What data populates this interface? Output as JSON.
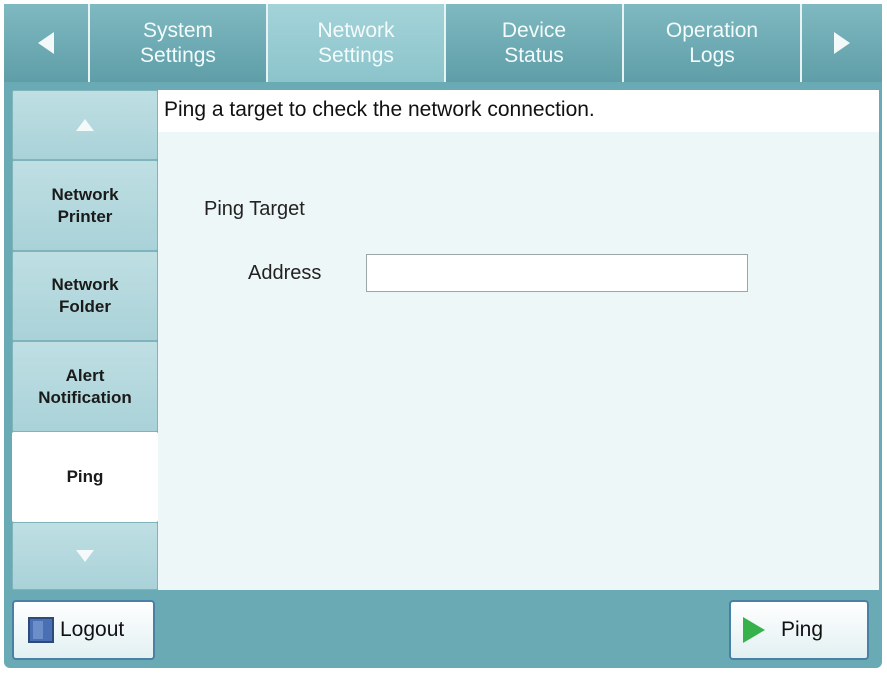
{
  "tabs": [
    {
      "label": "System\nSettings",
      "active": false
    },
    {
      "label": "Network\nSettings",
      "active": true
    },
    {
      "label": "Device\nStatus",
      "active": false
    },
    {
      "label": "Operation\nLogs",
      "active": false
    }
  ],
  "side_menu": {
    "items": [
      {
        "label": "Network\nPrinter",
        "selected": false
      },
      {
        "label": "Network\nFolder",
        "selected": false
      },
      {
        "label": "Alert\nNotification",
        "selected": false
      },
      {
        "label": "Ping",
        "selected": true
      }
    ]
  },
  "main": {
    "description": "Ping a target to check the network connection.",
    "section_title": "Ping Target",
    "address_label": "Address",
    "address_value": ""
  },
  "footer": {
    "logout_label": "Logout",
    "ping_label": "Ping"
  },
  "colors": {
    "frame": "#6aaab4",
    "tab_active": "#a3d3d9",
    "content_bg": "#eef7f8",
    "ping_icon": "#37b24a"
  }
}
